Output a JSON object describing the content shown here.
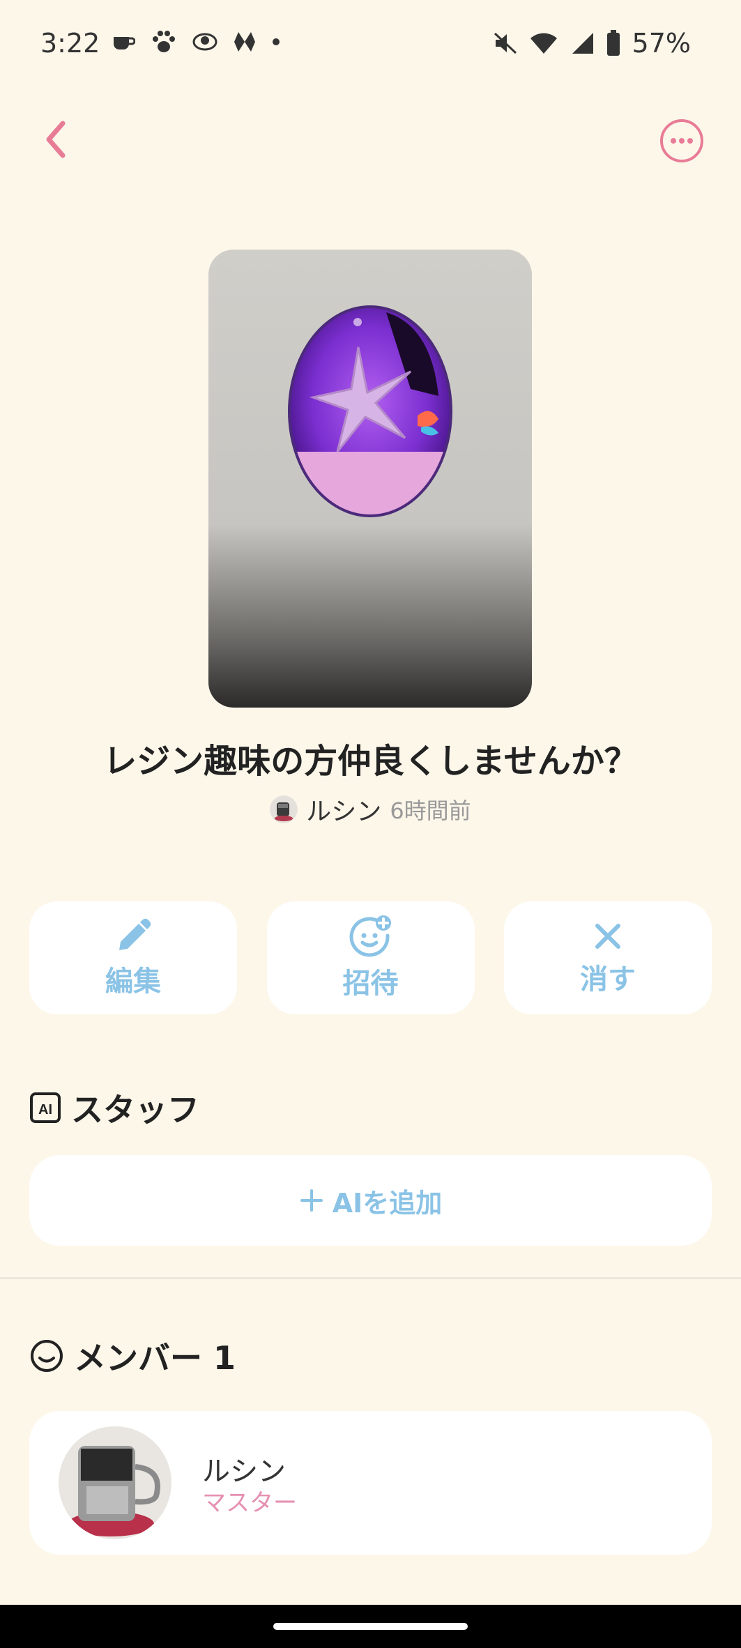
{
  "status_bar": {
    "time": "3:22",
    "battery": "57%",
    "left_icons": [
      "cup-icon",
      "paw-icon",
      "eye-icon",
      "app-icon",
      "dot-icon"
    ],
    "right_icons": [
      "mute-icon",
      "wifi-icon",
      "signal-icon",
      "battery-icon"
    ]
  },
  "header": {
    "back_icon": "chevron-left-icon",
    "more_icon": "more-horizontal-icon",
    "accent": "#e87c97"
  },
  "post": {
    "title": "レジン趣味の方仲良くしませんか？",
    "author_name": "ルシン",
    "time_ago": "6時間前"
  },
  "actions": [
    {
      "label": "編集",
      "icon": "pencil-icon"
    },
    {
      "label": "招待",
      "icon": "invite-face-icon"
    },
    {
      "label": "消す",
      "icon": "close-icon"
    }
  ],
  "staff_section": {
    "title": "スタッフ",
    "icon": "ai-icon",
    "add_label": "AIを追加"
  },
  "members_section": {
    "title": "メンバー 1",
    "icon": "smile-icon",
    "members": [
      {
        "name": "ルシン",
        "role": "マスター"
      }
    ]
  },
  "colors": {
    "background": "#fdf7ea",
    "action_blue": "#8ac3e6",
    "role_pink": "#e58fb1"
  }
}
